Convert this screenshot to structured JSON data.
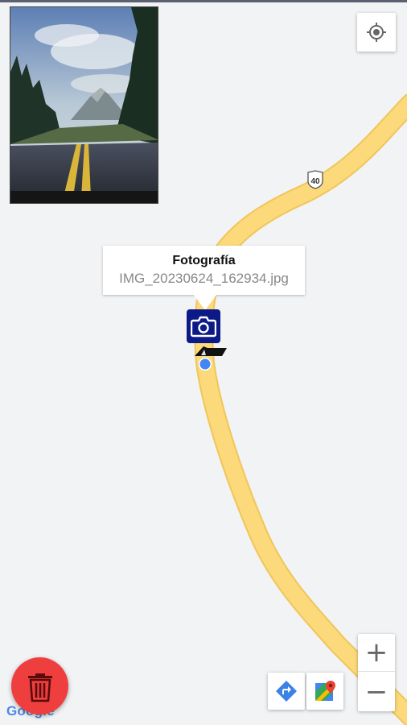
{
  "map": {
    "background_color": "#f1f3f4",
    "road_color": "#fcd97a",
    "road_edge_color": "#f0c65a",
    "route_shield_label": "40",
    "location_dot_color": "#4285f4"
  },
  "photo": {
    "description": "road-landscape-thumbnail"
  },
  "info_window": {
    "title": "Fotografía",
    "filename": "IMG_20230624_162934.jpg"
  },
  "marker": {
    "icon": "camera-icon",
    "color": "#0b1a86"
  },
  "controls": {
    "locate_icon": "my-location-icon",
    "zoom_in": "+",
    "zoom_out": "−",
    "directions_icon": "directions-icon",
    "maps_icon": "google-maps-icon"
  },
  "fab": {
    "icon": "trash-icon",
    "color": "#ef3e3e"
  },
  "attribution": {
    "logo_text": "Google"
  }
}
